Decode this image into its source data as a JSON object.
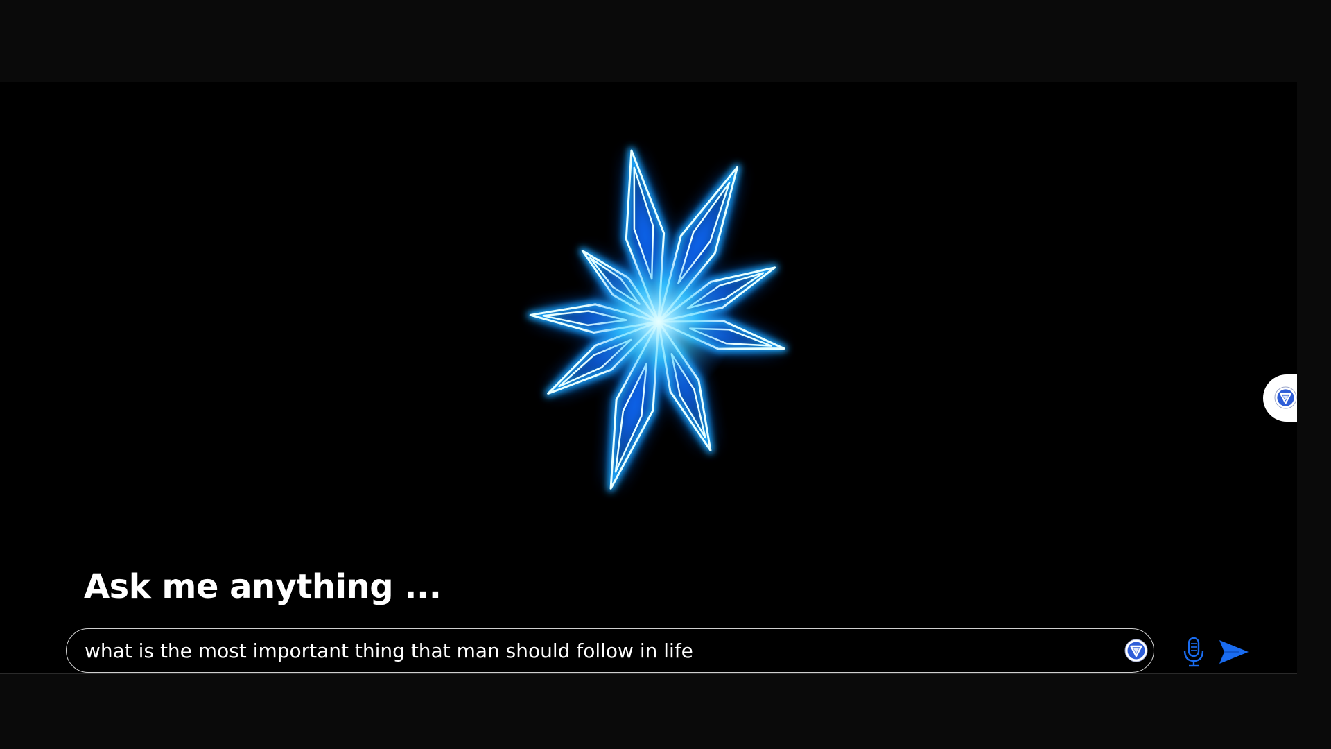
{
  "prompt": {
    "heading": "Ask me anything ...",
    "query_value": "what is the most important thing that man should follow in life",
    "query_placeholder": ""
  },
  "icons": {
    "center_graphic": "glowing-star-icon",
    "input_badge": "assistant-logo-icon",
    "mic": "microphone-icon",
    "send": "send-arrow-icon",
    "side_tab": "assistant-logo-icon"
  },
  "colors": {
    "background": "#000000",
    "frame": "#0a0a0a",
    "star_glow": "#0a6cff",
    "star_core": "#e8ffff",
    "accent_blue": "#1a6cf0",
    "text": "#ffffff"
  }
}
